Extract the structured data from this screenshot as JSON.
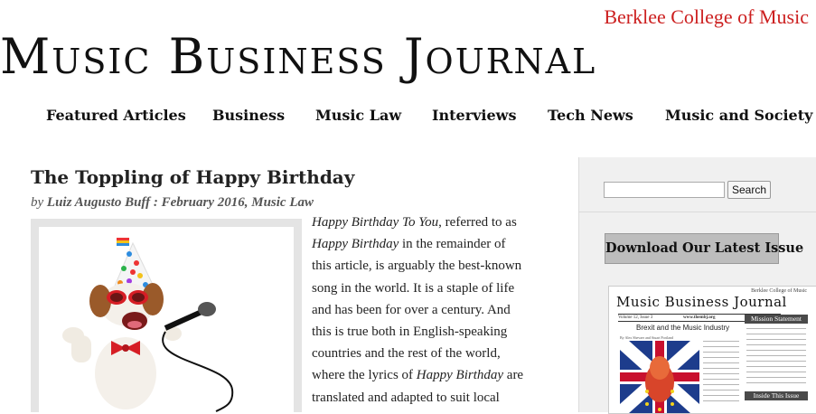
{
  "header": {
    "college": "Berklee College of Music",
    "masthead": "Music Business Journal"
  },
  "nav": {
    "items": [
      {
        "label": "Featured Articles"
      },
      {
        "label": "Business"
      },
      {
        "label": "Music Law"
      },
      {
        "label": "Interviews"
      },
      {
        "label": "Tech News"
      },
      {
        "label": "Music and Society"
      }
    ]
  },
  "article": {
    "title": "The Toppling of Happy Birthday",
    "by": "by",
    "author": "Luiz Augusto Buff",
    "sep": " : ",
    "date": "February 2016",
    "comma": ", ",
    "category": "Music Law",
    "lines": [
      {
        "pre": "",
        "em": "Happy Birthday To You",
        "post": ", referred to as"
      },
      {
        "pre": "",
        "em": "Happy Birthday",
        "post": " in the remainder of"
      },
      {
        "pre": "this article, is arguably the best-known",
        "em": "",
        "post": ""
      },
      {
        "pre": "song in the world. It is a staple of life",
        "em": "",
        "post": ""
      },
      {
        "pre": "and has been for over a century. And",
        "em": "",
        "post": ""
      },
      {
        "pre": "this is true both in English-speaking",
        "em": "",
        "post": ""
      },
      {
        "pre": "countries and the rest of the world,",
        "em": "",
        "post": ""
      },
      {
        "pre": "where the lyrics of ",
        "em": "Happy Birthday",
        "post": " are"
      },
      {
        "pre": "translated and adapted to suit local",
        "em": "",
        "post": ""
      }
    ]
  },
  "sidebar": {
    "search_placeholder": "",
    "search_button": "Search",
    "download_label": "Download Our Latest Issue",
    "cover": {
      "college": "Berklee College of Music",
      "title": "Music Business Journal",
      "volume": "Volume 12, Issue 3",
      "url": "www.thembj.org",
      "month": "September 2016",
      "headline": "Brexit and the Music Industry",
      "author": "By Alex Shevaer and Stuart Portland",
      "mission": "Mission Statement",
      "inside": "Inside This Issue"
    }
  },
  "colors": {
    "college_red": "#cc1f1f",
    "download_bg": "#bdbdbd",
    "sidebar_bg": "#f0f0f0"
  }
}
